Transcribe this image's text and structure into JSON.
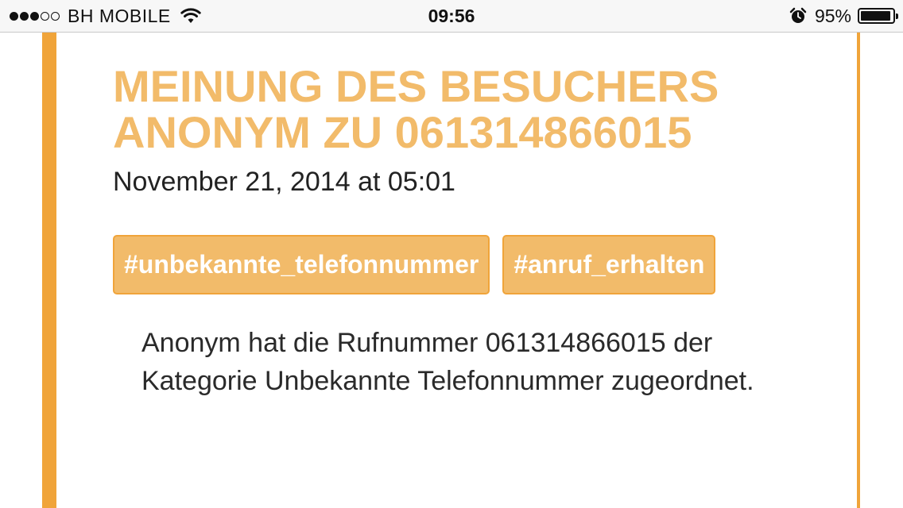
{
  "status_bar": {
    "carrier": "BH MOBILE",
    "signal_bars_filled": 3,
    "signal_bars_total": 5,
    "time": "09:56",
    "battery_percent": "95%",
    "battery_level": 0.95,
    "icons": [
      "wifi-icon",
      "alarm-icon",
      "battery-icon"
    ]
  },
  "colors": {
    "accent": "#f0a43a",
    "title": "#f2bb6a",
    "tag_bg": "#f2bb6a",
    "text": "#222222"
  },
  "post": {
    "title": "MEINUNG DES BESUCHERS ANONYM ZU 061314866015",
    "date": "November 21, 2014 at 05:01",
    "tags": [
      "#unbekannte_telefonnummer",
      "#anruf_erhalten"
    ],
    "body": "Anonym hat die Rufnummer 061314866015 der Kategorie Unbekannte Telefonnummer zugeordnet."
  }
}
